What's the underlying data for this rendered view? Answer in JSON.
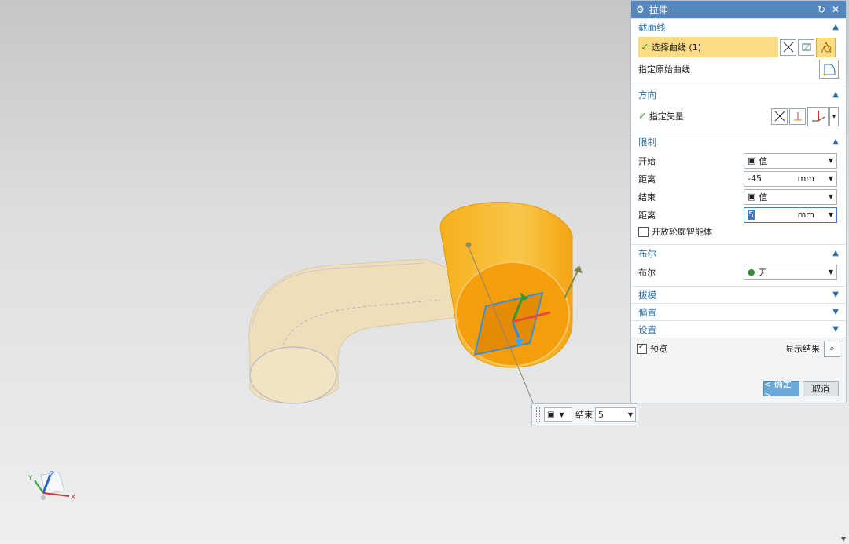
{
  "dialog": {
    "title": "拉伸",
    "sections": {
      "section_curve": {
        "header": "截面线",
        "select_curve_label": "选择曲线 (1)",
        "specify_original_curve": "指定原始曲线"
      },
      "direction": {
        "header": "方向",
        "specify_vector": "指定矢量"
      },
      "limits": {
        "header": "限制",
        "start_label": "开始",
        "start_value": "值",
        "distance1_label": "距离",
        "distance1_value": "-45",
        "distance1_unit": "mm",
        "end_label": "结束",
        "end_value": "值",
        "distance2_label": "距离",
        "distance2_value": "5",
        "distance2_unit": "mm",
        "open_profile_label": "开放轮廓智能体"
      },
      "boolean": {
        "header": "布尔",
        "boolean_label": "布尔",
        "boolean_value": "无"
      },
      "draft": {
        "header": "拔模"
      },
      "offset": {
        "header": "偏置"
      },
      "settings": {
        "header": "设置"
      }
    },
    "preview_label": "预览",
    "show_result_label": "显示结果",
    "ok_label": "< 确定 >",
    "cancel_label": "取消"
  },
  "floating_input": {
    "label": "结束",
    "value": "5"
  },
  "triad": {
    "x": "X",
    "y": "Y",
    "z": "Z"
  },
  "colors": {
    "title_bar": "#5587bd",
    "highlight": "#fbdc84",
    "cylinder": "#f5a414",
    "tube": "#f1dfb3",
    "section_header_text": "#2d6fa8"
  },
  "icons": {
    "title": "gear-icon",
    "reset": "reset-icon",
    "close": "close-icon",
    "collapse": "chevron-up-icon",
    "expand": "chevron-down-icon",
    "check": "check-icon",
    "search": "magnifier-icon"
  }
}
